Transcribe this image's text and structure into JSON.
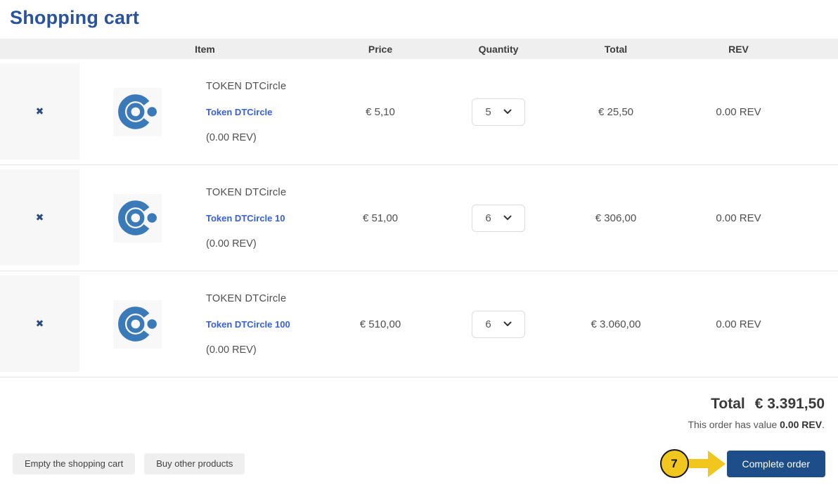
{
  "page": {
    "title": "Shopping cart"
  },
  "icons": {
    "remove": "✖"
  },
  "table": {
    "headers": {
      "item": "Item",
      "price": "Price",
      "quantity": "Quantity",
      "total": "Total",
      "rev": "REV"
    },
    "rows": [
      {
        "name": "TOKEN DTCircle",
        "link": "Token DTCircle",
        "rev_note": "(0.00 REV)",
        "price": "€ 5,10",
        "quantity": "5",
        "total": "€ 25,50",
        "rev": "0.00 REV"
      },
      {
        "name": "TOKEN DTCircle",
        "link": "Token DTCircle 10",
        "rev_note": "(0.00 REV)",
        "price": "€ 51,00",
        "quantity": "6",
        "total": "€ 306,00",
        "rev": "0.00 REV"
      },
      {
        "name": "TOKEN DTCircle",
        "link": "Token DTCircle 100",
        "rev_note": "(0.00 REV)",
        "price": "€ 510,00",
        "quantity": "6",
        "total": "€ 3.060,00",
        "rev": "0.00 REV"
      }
    ]
  },
  "summary": {
    "total_label": "Total",
    "total_value": "€ 3.391,50",
    "order_value_text": "This order has value ",
    "order_value_bold": "0.00 REV",
    "order_value_suffix": "."
  },
  "actions": {
    "empty_cart": "Empty the shopping cart",
    "buy_other": "Buy other products",
    "complete_order": "Complete order"
  },
  "annotation": {
    "step": "7"
  },
  "colors": {
    "title_blue": "#29549d",
    "link_blue": "#3560dd",
    "logo_blue": "#3b7ab8",
    "button_blue": "#1d4e89",
    "annotation_yellow": "#f2c71d",
    "header_gray": "#efefef"
  }
}
